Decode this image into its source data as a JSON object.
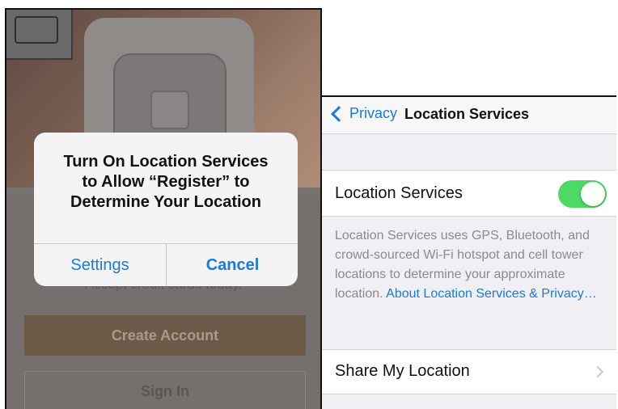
{
  "left": {
    "alert": {
      "title_line1": "Turn On Location Services",
      "title_line2": "to Allow “Register” to",
      "title_line3": "Determine Your Location",
      "settings_label": "Settings",
      "cancel_label": "Cancel"
    },
    "tagline": "Accept credit cards today.",
    "create_account_label": "Create Account",
    "sign_in_label": "Sign In"
  },
  "right": {
    "nav": {
      "back_label": "Privacy",
      "title": "Location Services"
    },
    "location_services": {
      "label": "Location Services",
      "enabled": true
    },
    "description": {
      "text": "Location Services uses GPS, Bluetooth, and crowd-sourced Wi-Fi hotspot and cell tower locations to determine your approximate location. ",
      "link": "About Location Services & Privacy…"
    },
    "share_my_location": {
      "label": "Share My Location"
    }
  },
  "colors": {
    "ios_blue": "#1a7adf",
    "toggle_on": "#4cd964",
    "create_button": "#6b5a48"
  },
  "icons": {
    "back": "chevron-left-icon",
    "disclosure": "chevron-right-icon"
  }
}
